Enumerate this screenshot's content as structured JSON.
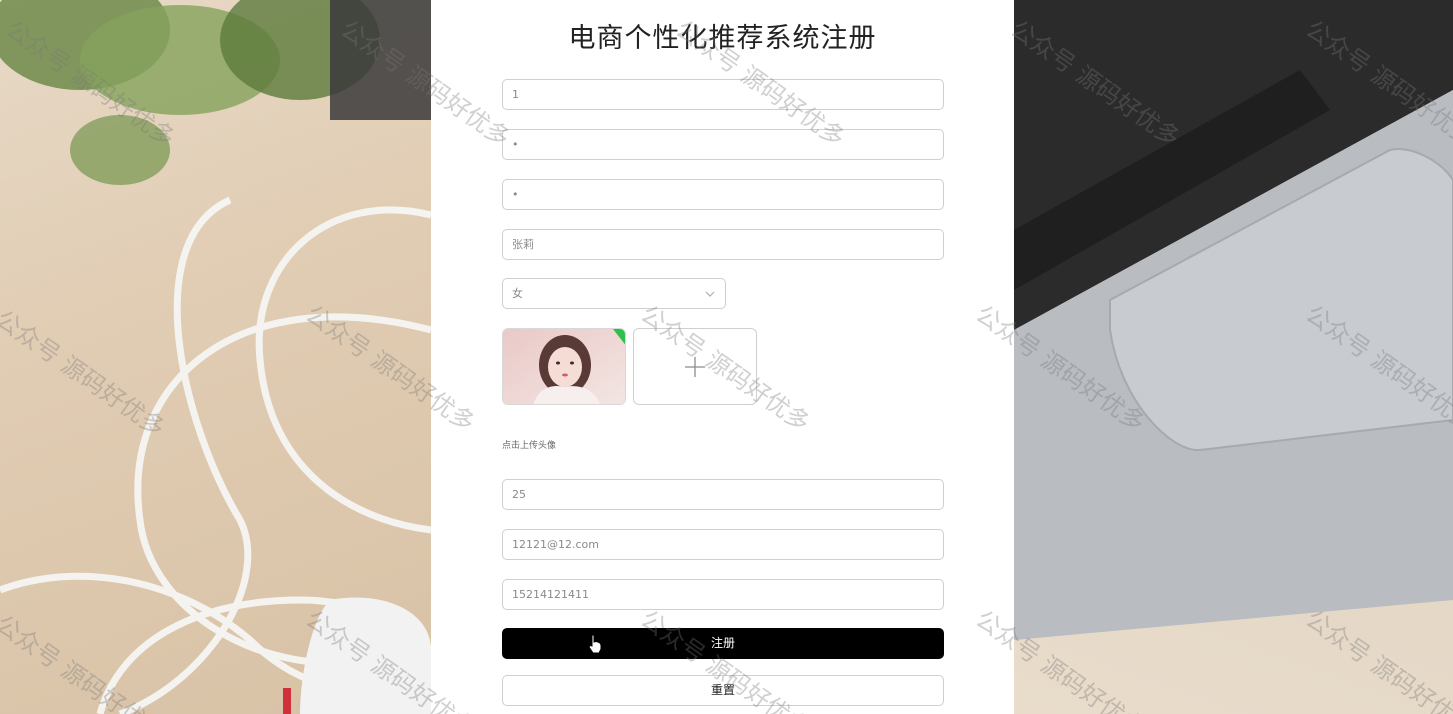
{
  "page": {
    "title": "电商个性化推荐系统注册"
  },
  "form": {
    "account_value": "1",
    "password_value": "•",
    "confirm_password_value": "•",
    "name_value": "张莉",
    "gender_selected": "女",
    "upload_hint": "点击上传头像",
    "age_value": "25",
    "email_value": "12121@12.com",
    "phone_value": "15214121411",
    "register_label": "注册",
    "reset_label": "重置"
  },
  "icons": {
    "chevron": "chevron-down-icon",
    "plus": "plus-icon",
    "cursor": "hand-pointer-icon"
  },
  "colors": {
    "primary_button": "#000000",
    "card_background": "#ffffff"
  },
  "watermark": {
    "text": "公众号 源码好优多"
  }
}
